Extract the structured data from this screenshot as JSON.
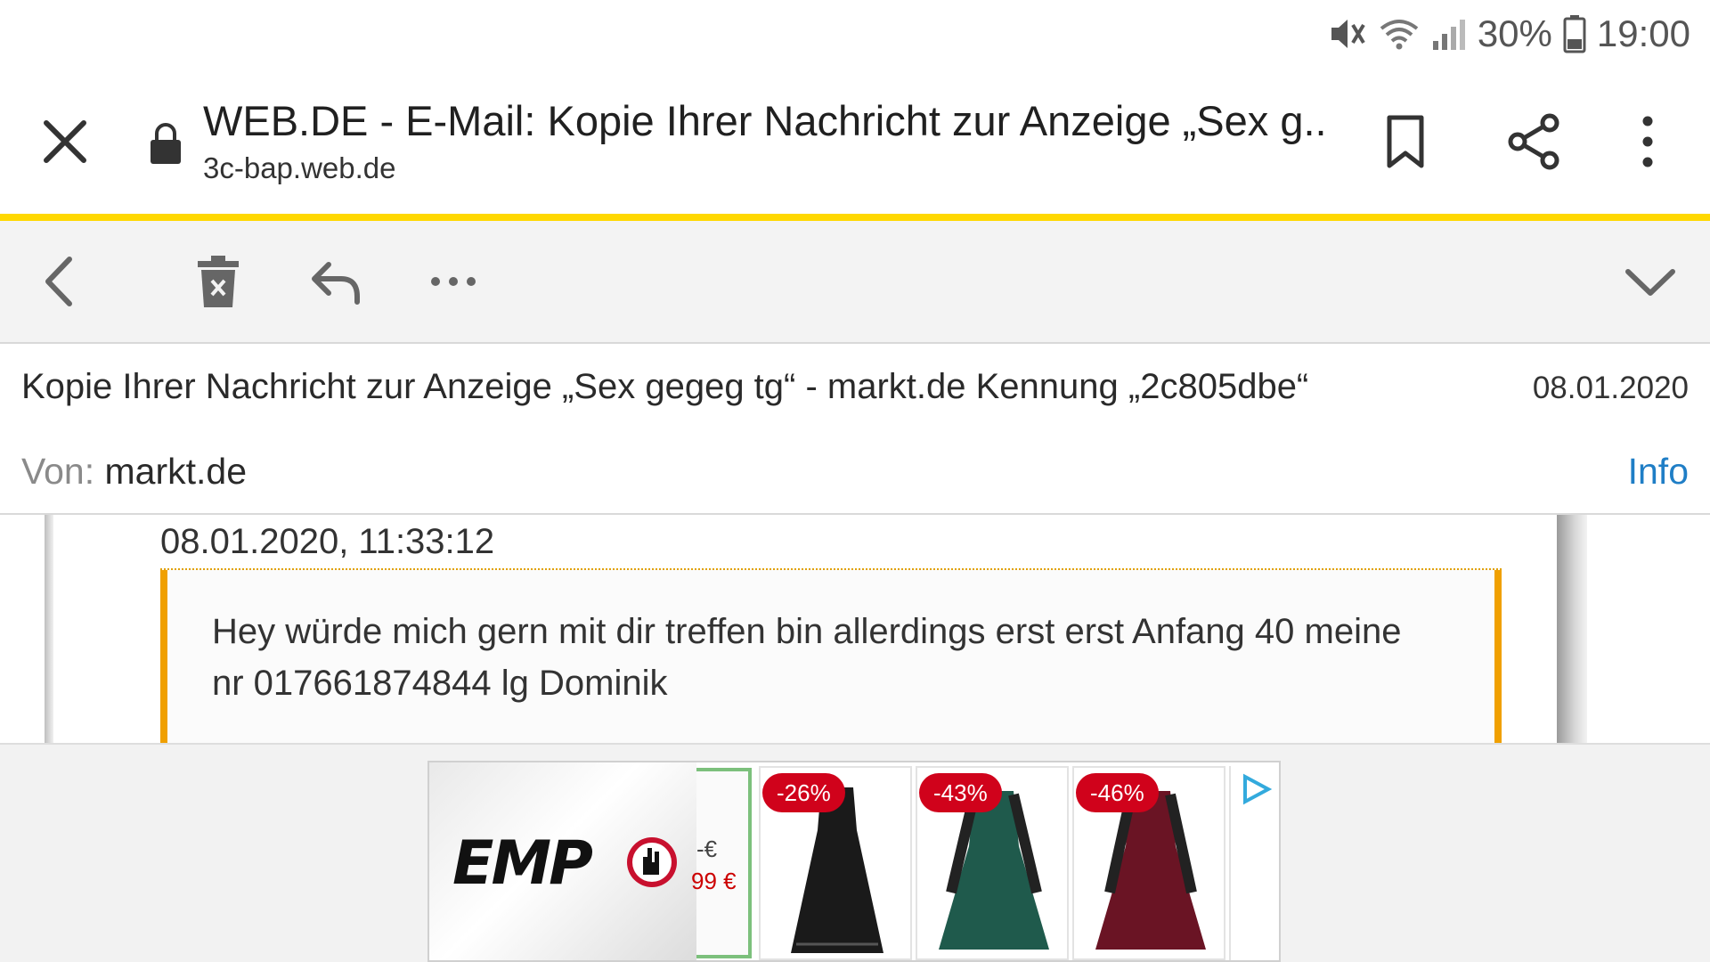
{
  "status_bar": {
    "battery_percent": "30%",
    "time": "19:00",
    "icons": [
      "mute-icon",
      "wifi-icon",
      "signal-icon",
      "battery-icon"
    ]
  },
  "tab_bar": {
    "title": "WEB.DE - E-Mail: Kopie Ihrer Nachricht zur Anzeige „Sex g...",
    "url": "3c-bap.web.de",
    "icons": [
      "close-icon",
      "lock-icon",
      "bookmark-icon",
      "share-icon",
      "more-vert-icon"
    ],
    "accent_color": "#ffd800"
  },
  "mail_toolbar": {
    "icons": [
      "back-icon",
      "delete-icon",
      "reply-icon",
      "more-horiz-icon",
      "expand-icon"
    ]
  },
  "mail_header": {
    "subject": "Kopie Ihrer Nachricht zur Anzeige „Sex gegeg tg“ - markt.de Kennung „2c805dbe“",
    "date": "08.01.2020",
    "from_label": "Von:",
    "from_value": "markt.de",
    "info_link": "Info",
    "link_color": "#1f7ec6"
  },
  "message": {
    "timestamp": "08.01.2020, 11:33:12",
    "text": "Hey würde mich gern mit dir treffen bin allerdings erst erst Anfang 40 meine nr 017661874844 lg Dominik",
    "border_color": "#f0a000"
  },
  "ad": {
    "brand": "EMP",
    "prev_price_old": "-€",
    "prev_price_new": "99 €",
    "items": [
      {
        "discount": "-26%",
        "dress_color": "#1a1a1a"
      },
      {
        "discount": "-43%",
        "dress_color": "#1f5a4c"
      },
      {
        "discount": "-46%",
        "dress_color": "#6a1424"
      }
    ],
    "badge_color": "#d0021b"
  }
}
